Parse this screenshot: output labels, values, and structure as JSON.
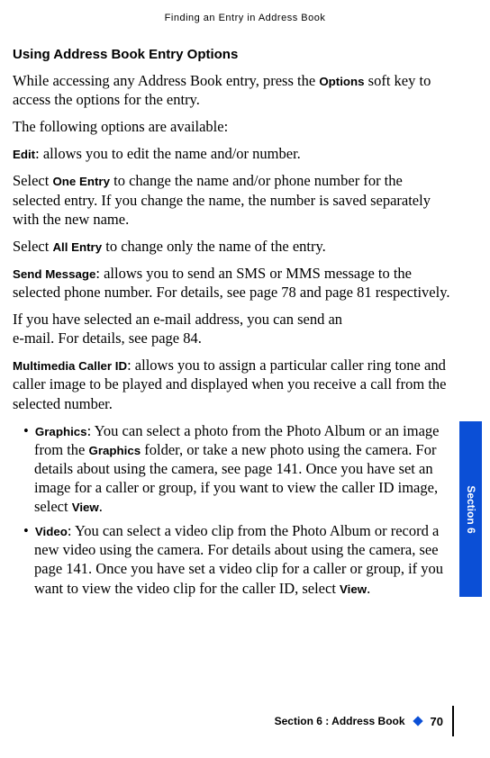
{
  "runningHeader": "Finding an Entry in Address Book",
  "heading": "Using Address Book Entry Options",
  "p1_pre": "While accessing any Address Book entry, press the ",
  "p1_b1": "Options",
  "p1_post": " soft key to access the options for the entry.",
  "p2": "The following options are available:",
  "p3_b": "Edit",
  "p3_post": ": allows you to edit the name and/or number.",
  "p4_pre": "Select ",
  "p4_b": "One Entry",
  "p4_post": " to change the name and/or phone number for the selected entry. If you change the name, the number is saved separately with the new name.",
  "p5_pre": "Select ",
  "p5_b": "All Entry",
  "p5_post": " to change only the name of the entry.",
  "p6_b": "Send Message",
  "p6_post": ": allows you to send an SMS or MMS message to the selected phone number. For details, see page 78 and page 81 respectively.",
  "p7a": "If you have selected an e-mail address, you can send an",
  "p7b": "e-mail. For details, see page 84.",
  "p8_b": "Multimedia Caller ID",
  "p8_post": ": allows you to assign a particular caller ring tone and caller image to be played and displayed when you receive a call from the selected number.",
  "bullet1_b": "Graphics",
  "bullet1_mid": ": You can select a photo from the Photo Album or an image from the ",
  "bullet1_b2": "Graphics",
  "bullet1_post": " folder, or take a new photo using the camera. For details about using the camera, see page 141. Once you have set an image for a caller or group, if you want to view the caller ID image, select ",
  "bullet1_b3": "View",
  "bullet1_end": ".",
  "bullet2_b": "Video",
  "bullet2_post": ": You can select a video clip from the Photo Album or record a new video using the camera. For details about using the camera, see page 141. Once you have set a video clip for a caller or group, if you want to view the video clip for the caller ID, select ",
  "bullet2_b2": "View",
  "bullet2_end": ".",
  "sectionTab": "Section 6",
  "footerSection": "Section 6 : Address Book",
  "pageNumber": "70"
}
